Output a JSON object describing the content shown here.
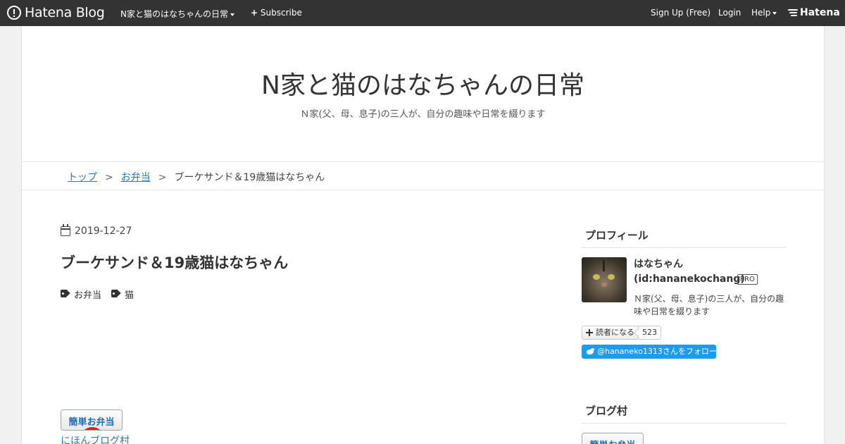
{
  "globalheader": {
    "brand_logo_text": "Hatena Blog",
    "blog_menu_label": "N家と猫のはなちゃんの日常",
    "subscribe_label": "Subscribe",
    "signup_label": "Sign Up (Free)",
    "login_label": "Login",
    "help_label": "Help",
    "hatena_label": "Hatena"
  },
  "blog": {
    "title": "N家と猫のはなちゃんの日常",
    "description": "Ｎ家(父、母、息子)の三人が、自分の趣味や日常を綴ります"
  },
  "breadcrumb": {
    "items": [
      "トップ",
      "お弁当",
      "ブーケサンド＆19歳猫はなちゃん"
    ],
    "separator": ">"
  },
  "entry": {
    "date": "2019-12-27",
    "title": "ブーケサンド＆19歳猫はなちゃん",
    "categories": [
      "お弁当",
      "猫"
    ],
    "banner_text": "簡単お弁当",
    "banner_link": "にほんブログ村"
  },
  "sidebar": {
    "profile": {
      "heading": "プロフィール",
      "name": "はなちゃん",
      "id": "(id:hananekochang)",
      "badge": "PRO",
      "description": "Ｎ家(父、母、息子)の三人が、自分の趣味や日常を綴ります",
      "reader_button": "読者になる",
      "reader_count": "523",
      "twitter_follow": "@hananeko1313さんをフォロー"
    },
    "blogmura": {
      "heading": "ブログ村",
      "banner_text": "簡単お弁当"
    }
  },
  "colors": {
    "header_bg": "#333333",
    "link": "#2a7ab0",
    "twitter": "#1d9bf0"
  }
}
